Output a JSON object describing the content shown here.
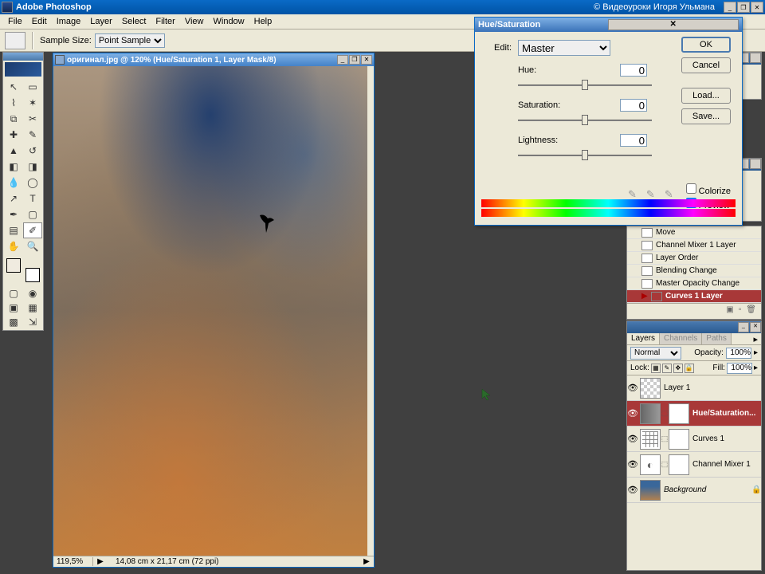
{
  "app": {
    "title": "Adobe Photoshop",
    "credits": "© Видеоуроки Игоря Ульмана"
  },
  "menu": [
    "File",
    "Edit",
    "Image",
    "Layer",
    "Select",
    "Filter",
    "View",
    "Window",
    "Help"
  ],
  "options_bar": {
    "sample_label": "Sample Size:",
    "sample_value": "Point Sample"
  },
  "document": {
    "title": "оригинал.jpg @ 120% (Hue/Saturation 1, Layer Mask/8)",
    "zoom": "119,5%",
    "info": "14,08 cm x 21,17 cm (72 ppi)"
  },
  "hue_sat": {
    "title": "Hue/Saturation",
    "edit_label": "Edit:",
    "edit_value": "Master",
    "hue_label": "Hue:",
    "hue_value": "0",
    "sat_label": "Saturation:",
    "sat_value": "0",
    "light_label": "Lightness:",
    "light_value": "0",
    "ok": "OK",
    "cancel": "Cancel",
    "load": "Load...",
    "save": "Save...",
    "colorize": "Colorize",
    "preview": "Preview"
  },
  "history": {
    "items": [
      {
        "label": "Move"
      },
      {
        "label": "Channel Mixer 1 Layer"
      },
      {
        "label": "Layer Order"
      },
      {
        "label": "Blending Change"
      },
      {
        "label": "Master Opacity Change"
      },
      {
        "label": "Curves 1 Layer"
      }
    ]
  },
  "layers": {
    "tab_layers": "Layers",
    "tab_channels": "Channels",
    "tab_paths": "Paths",
    "blend_mode": "Normal",
    "opacity_label": "Opacity:",
    "opacity_value": "100%",
    "lock_label": "Lock:",
    "fill_label": "Fill:",
    "fill_value": "100%",
    "rows": [
      {
        "name": "Layer 1"
      },
      {
        "name": "Hue/Saturation..."
      },
      {
        "name": "Curves 1"
      },
      {
        "name": "Channel Mixer 1"
      },
      {
        "name": "Background"
      }
    ]
  }
}
